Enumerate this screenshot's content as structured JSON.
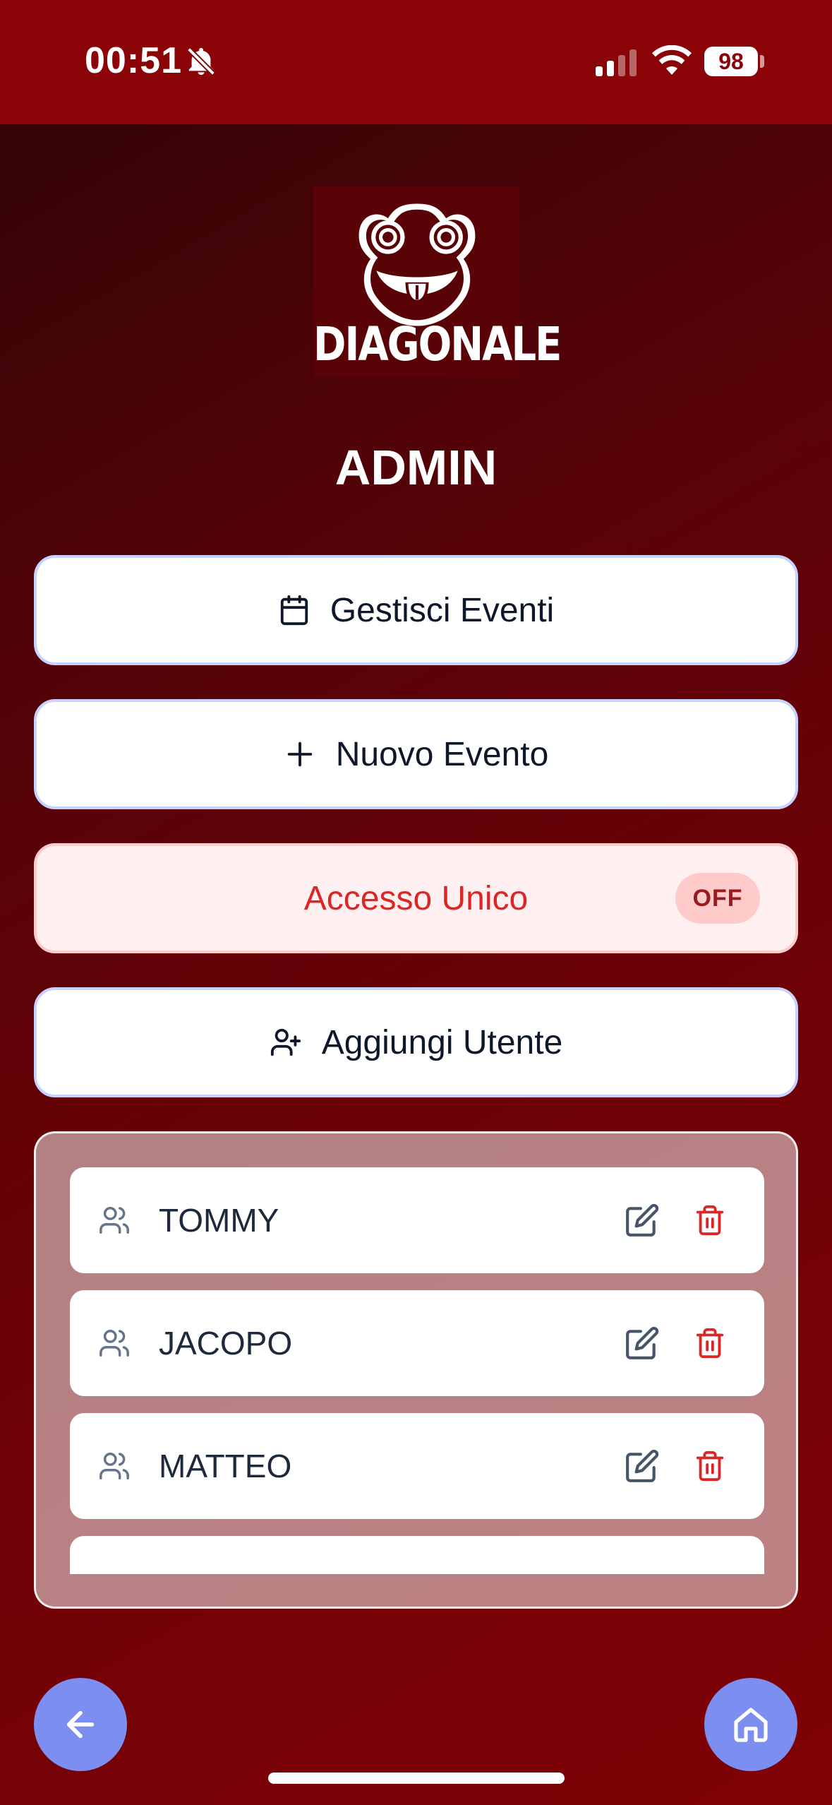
{
  "status_bar": {
    "time": "00:51",
    "battery": "98",
    "icons": [
      "bell-slash-icon",
      "signal-icon",
      "wifi-icon"
    ]
  },
  "logo": {
    "text": "DIAGONALE"
  },
  "page": {
    "title": "ADMIN"
  },
  "menu": {
    "manage_events": {
      "label": "Gestisci Eventi",
      "icon": "calendar-icon"
    },
    "new_event": {
      "label": "Nuovo Evento",
      "icon": "plus-icon"
    },
    "single_access": {
      "label": "Accesso Unico",
      "state": "OFF"
    },
    "add_user": {
      "label": "Aggiungi Utente",
      "icon": "user-plus-icon"
    }
  },
  "users": [
    {
      "name": "TOMMY"
    },
    {
      "name": "JACOPO"
    },
    {
      "name": "MATTEO"
    },
    {
      "name": ""
    }
  ],
  "colors": {
    "status_bar_bg": "#8b0407",
    "accent": "#7c8ef0",
    "danger": "#dc2626",
    "button_border": "#c7d2fe"
  }
}
